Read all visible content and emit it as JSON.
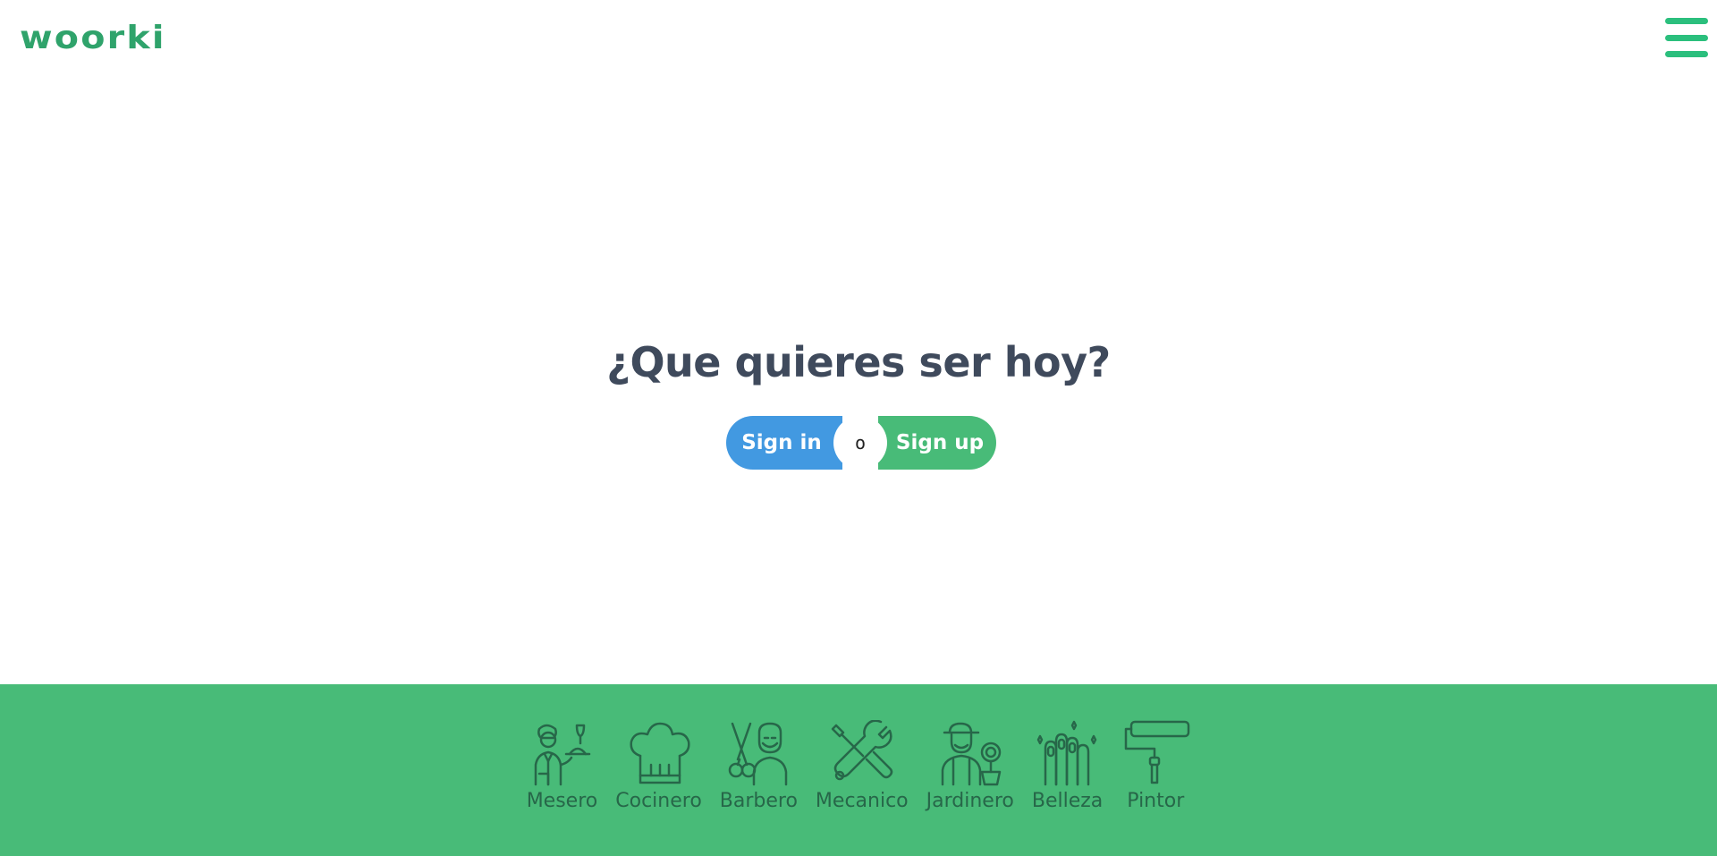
{
  "brand": {
    "logo_text": "woorki",
    "logo_color": "#2fa36b"
  },
  "header": {
    "menu_icon": "hamburger-menu-icon",
    "menu_color": "#2bbf7d"
  },
  "hero": {
    "title": "¿Que quieres ser hoy?"
  },
  "auth": {
    "signin_label": "Sign in",
    "or_label": "o",
    "signup_label": "Sign up",
    "signin_color": "#4299e1",
    "signup_color": "#48bb78"
  },
  "footer": {
    "background": "#48bb78",
    "categories": [
      {
        "label": "Mesero",
        "icon": "waiter-icon"
      },
      {
        "label": "Cocinero",
        "icon": "chef-hat-icon"
      },
      {
        "label": "Barbero",
        "icon": "barber-icon"
      },
      {
        "label": "Mecanico",
        "icon": "wrench-icon"
      },
      {
        "label": "Jardinero",
        "icon": "gardener-icon"
      },
      {
        "label": "Belleza",
        "icon": "nails-icon"
      },
      {
        "label": "Pintor",
        "icon": "paint-roller-icon"
      }
    ]
  }
}
